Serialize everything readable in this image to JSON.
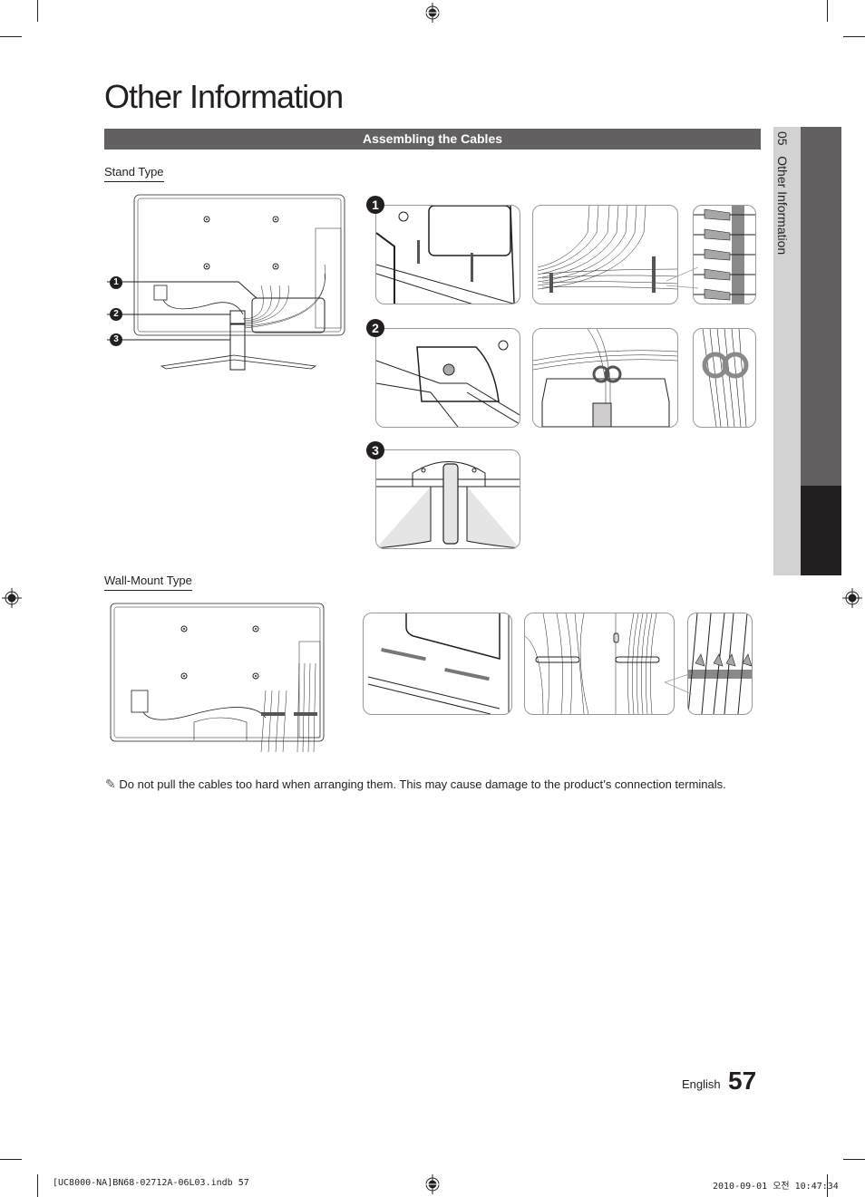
{
  "page": {
    "title": "Other Information",
    "section_title": "Assembling the Cables",
    "side_tab": {
      "chapter_number": "05",
      "chapter_title": "Other Information"
    },
    "stand_type": {
      "heading": "Stand Type",
      "callouts": [
        "1",
        "2",
        "3"
      ],
      "step_badges": [
        "1",
        "2",
        "3"
      ]
    },
    "wall_mount_type": {
      "heading": "Wall-Mount Type"
    },
    "note": {
      "icon": "pencil-note-icon",
      "text": "Do not pull the cables too hard when arranging them. This may cause damage to the product’s connection terminals."
    },
    "footer": {
      "language": "English",
      "page_number": "57"
    },
    "slug": {
      "file": "[UC8000-NA]BN68-02712A-06L03.indb   57",
      "timestamp": "2010-09-01   오전 10:47:34"
    },
    "colors": {
      "section_bar": "#626061",
      "tab_light": "#d3d2d2",
      "tab_dark": "#231f20",
      "text": "#231f20"
    }
  }
}
